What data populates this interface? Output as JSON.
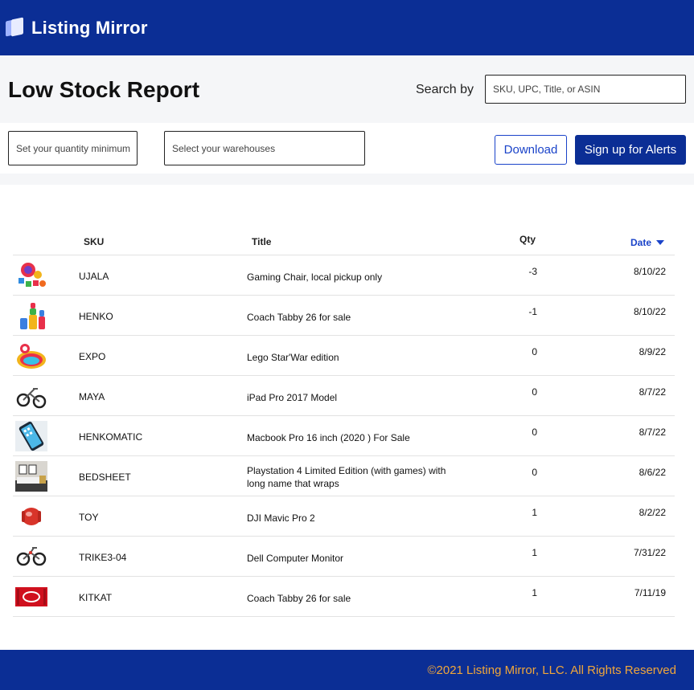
{
  "app": {
    "name": "Listing Mirror"
  },
  "header": {
    "page_title": "Low Stock Report",
    "search_label": "Search by",
    "search_placeholder": "SKU, UPC, Title, or ASIN"
  },
  "filters": {
    "quantity_placeholder": "Set your quantity minimum",
    "warehouse_placeholder": "Select your warehouses",
    "download_label": "Download",
    "alerts_label": "Sign up for Alerts"
  },
  "table": {
    "columns": {
      "sku": "SKU",
      "title": "Title",
      "qty": "Qty",
      "date": "Date"
    },
    "sorted_by": "Date",
    "rows": [
      {
        "thumb": "colorful-toy-set",
        "sku": "UJALA",
        "title": "Gaming Chair, local pickup only",
        "qty": "-3",
        "date": "8/10/22"
      },
      {
        "thumb": "stacking-rings-toy",
        "sku": "HENKO",
        "title": "Coach Tabby 26 for sale",
        "qty": "-1",
        "date": "8/10/22"
      },
      {
        "thumb": "inflatable-pool",
        "sku": "EXPO",
        "title": "Lego Star'War edition",
        "qty": "0",
        "date": "8/9/22"
      },
      {
        "thumb": "balance-bike",
        "sku": "MAYA",
        "title": "iPad Pro 2017 Model",
        "qty": "0",
        "date": "8/7/22"
      },
      {
        "thumb": "smartphone",
        "sku": "HENKOMATIC",
        "title": "Macbook Pro 16 inch (2020 ) For Sale",
        "qty": "0",
        "date": "8/7/22"
      },
      {
        "thumb": "bedroom",
        "sku": "BEDSHEET",
        "title": "Playstation 4 Limited Edition (with games) with long name that wraps",
        "qty": "0",
        "date": "8/6/22"
      },
      {
        "thumb": "red-toy",
        "sku": "TOY",
        "title": "DJI Mavic Pro 2",
        "qty": "1",
        "date": "8/2/22"
      },
      {
        "thumb": "balance-bike",
        "sku": "TRIKE3-04",
        "title": "Dell Computer Monitor",
        "qty": "1",
        "date": "7/31/22"
      },
      {
        "thumb": "kitkat-bar",
        "sku": "KITKAT",
        "title": "Coach Tabby 26 for sale",
        "qty": "1",
        "date": "7/11/19"
      }
    ]
  },
  "footer": {
    "copyright": "©2021 Listing Mirror, LLC. All Rights Reserved"
  },
  "colors": {
    "brand_navy": "#0b2e95",
    "link_blue": "#1a43c9",
    "footer_text": "#f0a63a",
    "panel_gray": "#f5f6f8"
  }
}
